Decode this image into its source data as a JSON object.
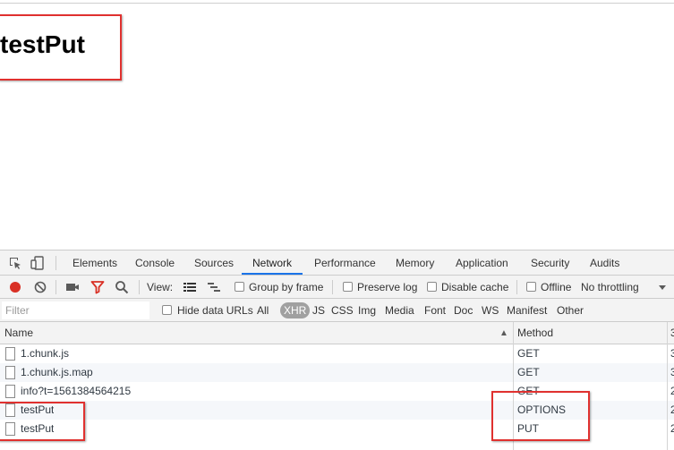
{
  "page": {
    "heading": "testPut"
  },
  "devtools": {
    "tabs": [
      {
        "label": "Elements",
        "active": false
      },
      {
        "label": "Console",
        "active": false
      },
      {
        "label": "Sources",
        "active": false
      },
      {
        "label": "Network",
        "active": true
      },
      {
        "label": "Performance",
        "active": false
      },
      {
        "label": "Memory",
        "active": false
      },
      {
        "label": "Application",
        "active": false
      },
      {
        "label": "Security",
        "active": false
      },
      {
        "label": "Audits",
        "active": false
      }
    ],
    "toolbar": {
      "view_label": "View:",
      "group_by_frame": "Group by frame",
      "preserve_log": "Preserve log",
      "disable_cache": "Disable cache",
      "offline": "Offline",
      "throttling": "No throttling",
      "record_color": "#d93025",
      "filter_icon_color": "#d93025"
    },
    "filter": {
      "placeholder": "Filter",
      "hide_data_urls": "Hide data URLs",
      "types": [
        "All",
        "XHR",
        "JS",
        "CSS",
        "Img",
        "Media",
        "Font",
        "Doc",
        "WS",
        "Manifest",
        "Other"
      ],
      "selected_type": "XHR"
    },
    "grid": {
      "columns": {
        "name": "Name",
        "method": "Method"
      },
      "sort_indicator": "▲",
      "rows": [
        {
          "name": "1.chunk.js",
          "method": "GET",
          "status": "3"
        },
        {
          "name": "1.chunk.js.map",
          "method": "GET",
          "status": "3"
        },
        {
          "name": "info?t=1561384564215",
          "method": "GET",
          "status": "2"
        },
        {
          "name": "testPut",
          "method": "OPTIONS",
          "status": "2"
        },
        {
          "name": "testPut",
          "method": "PUT",
          "status": "2"
        }
      ]
    }
  },
  "highlight_color": "#e0312f"
}
